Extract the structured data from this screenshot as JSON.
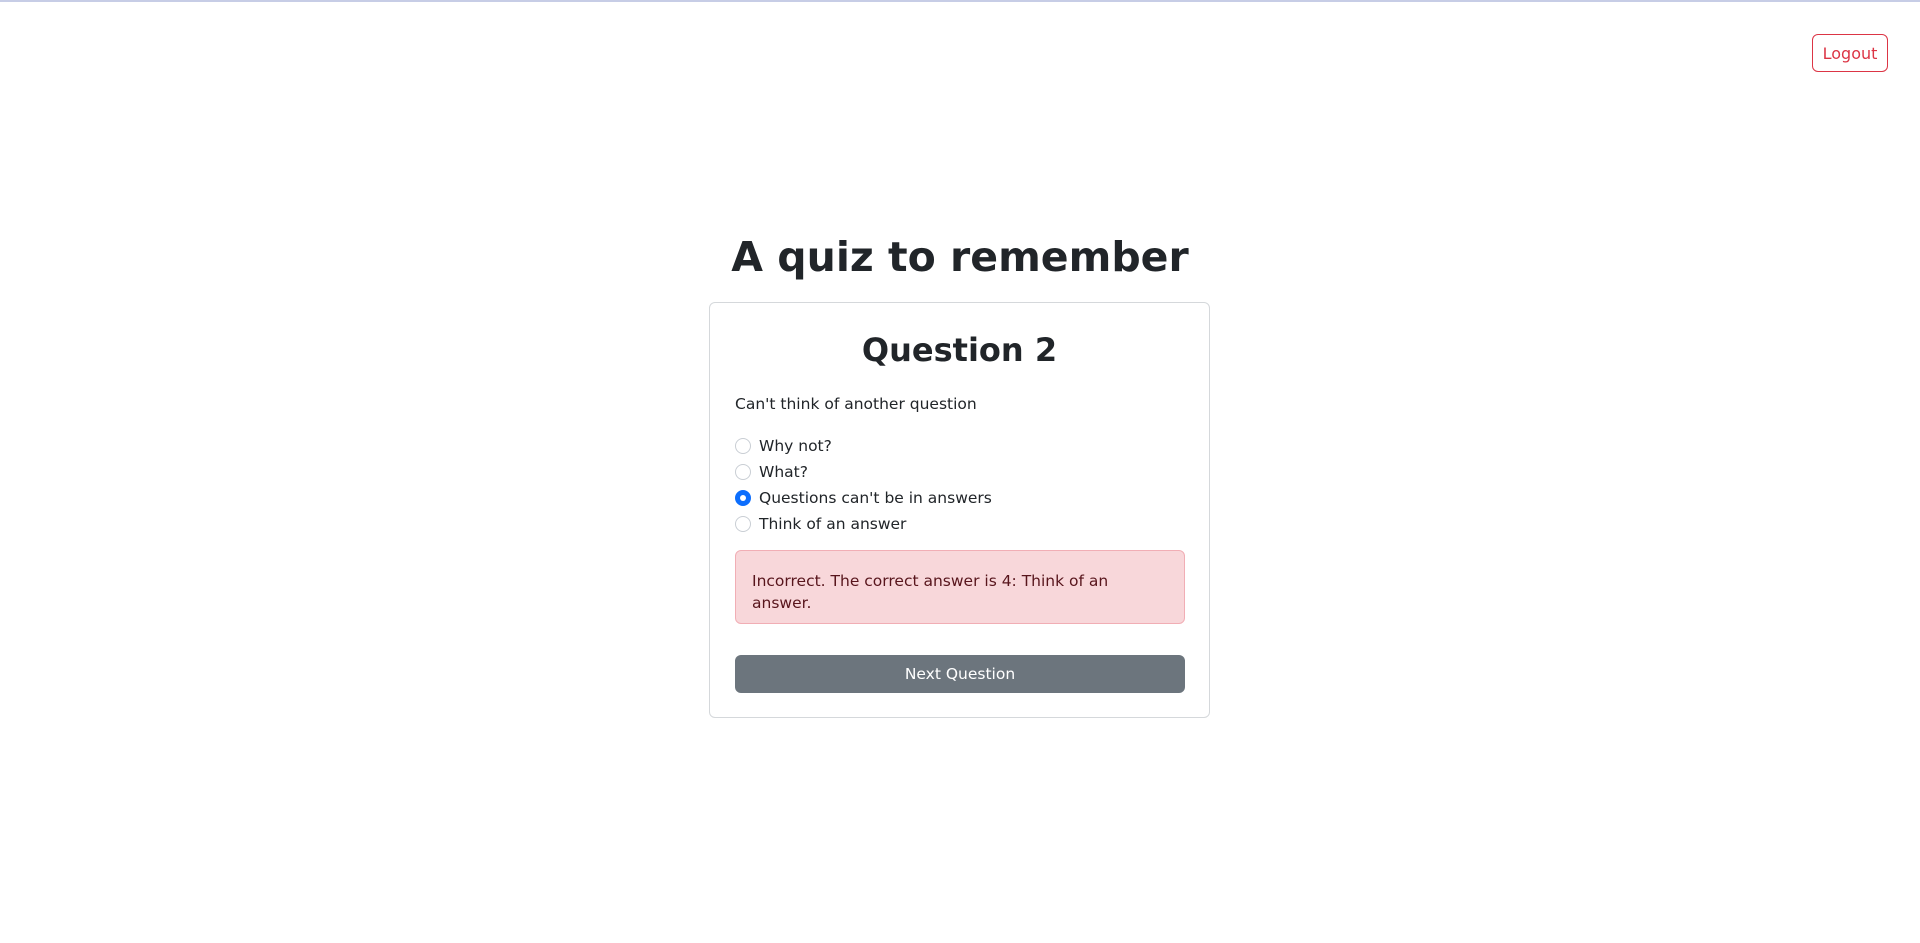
{
  "header": {
    "logout_label": "Logout"
  },
  "page": {
    "title": "A quiz to remember"
  },
  "question": {
    "title": "Question 2",
    "text": "Can't think of another question",
    "options": [
      {
        "label": "Why not?",
        "selected": false
      },
      {
        "label": "What?",
        "selected": false
      },
      {
        "label": "Questions can't be in answers",
        "selected": true
      },
      {
        "label": "Think of an answer",
        "selected": false
      }
    ],
    "feedback": "Incorrect. The correct answer is 4: Think of an answer.",
    "next_label": "Next Question"
  },
  "colors": {
    "accent": "#0d6efd",
    "danger": "#dc3545",
    "alert_bg": "#f8d7da",
    "button_secondary": "#6c757d"
  }
}
